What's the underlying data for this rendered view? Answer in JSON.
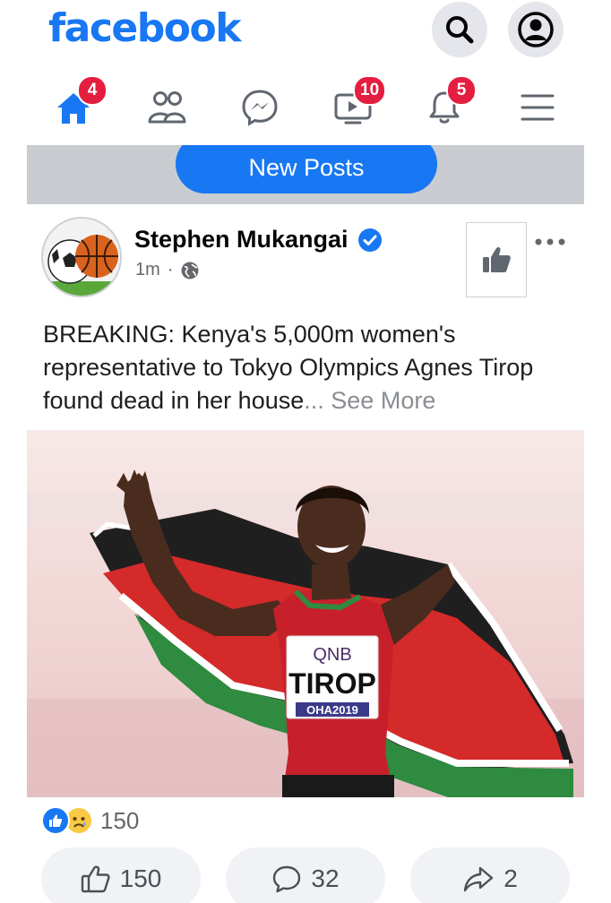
{
  "app": {
    "logo_text": "facebook",
    "brand_color": "#1877f2",
    "badge_color": "#e41e3f"
  },
  "header_icons": [
    {
      "name": "search-icon"
    },
    {
      "name": "profile-icon"
    }
  ],
  "nav": {
    "items": [
      {
        "name": "home",
        "icon": "home-icon",
        "badge": "4"
      },
      {
        "name": "friends",
        "icon": "friends-icon",
        "badge": ""
      },
      {
        "name": "messenger",
        "icon": "messenger-icon",
        "badge": ""
      },
      {
        "name": "watch",
        "icon": "video-icon",
        "badge": "10"
      },
      {
        "name": "notifications",
        "icon": "bell-icon",
        "badge": "5"
      },
      {
        "name": "menu",
        "icon": "hamburger-icon",
        "badge": ""
      }
    ]
  },
  "new_posts": {
    "label": "New Posts"
  },
  "post": {
    "author": "Stephen Mukangai",
    "verified": true,
    "time": "1m",
    "separator": "·",
    "audience_icon": "globe-icon",
    "text": "BREAKING: Kenya's 5,000m women's representative to Tokyo Olympics Agnes Tirop found dead in her house",
    "ellipsis": "...",
    "see_more": "See More",
    "image": {
      "bib_sponsor": "QNB",
      "bib_name": "TIROP",
      "bib_event": "OHA2019"
    },
    "reactions": {
      "icons": [
        "like-reaction-icon",
        "sad-reaction-icon"
      ],
      "count": "150"
    },
    "actions": {
      "like_count": "150",
      "comment_count": "32",
      "share_count": "2"
    }
  }
}
